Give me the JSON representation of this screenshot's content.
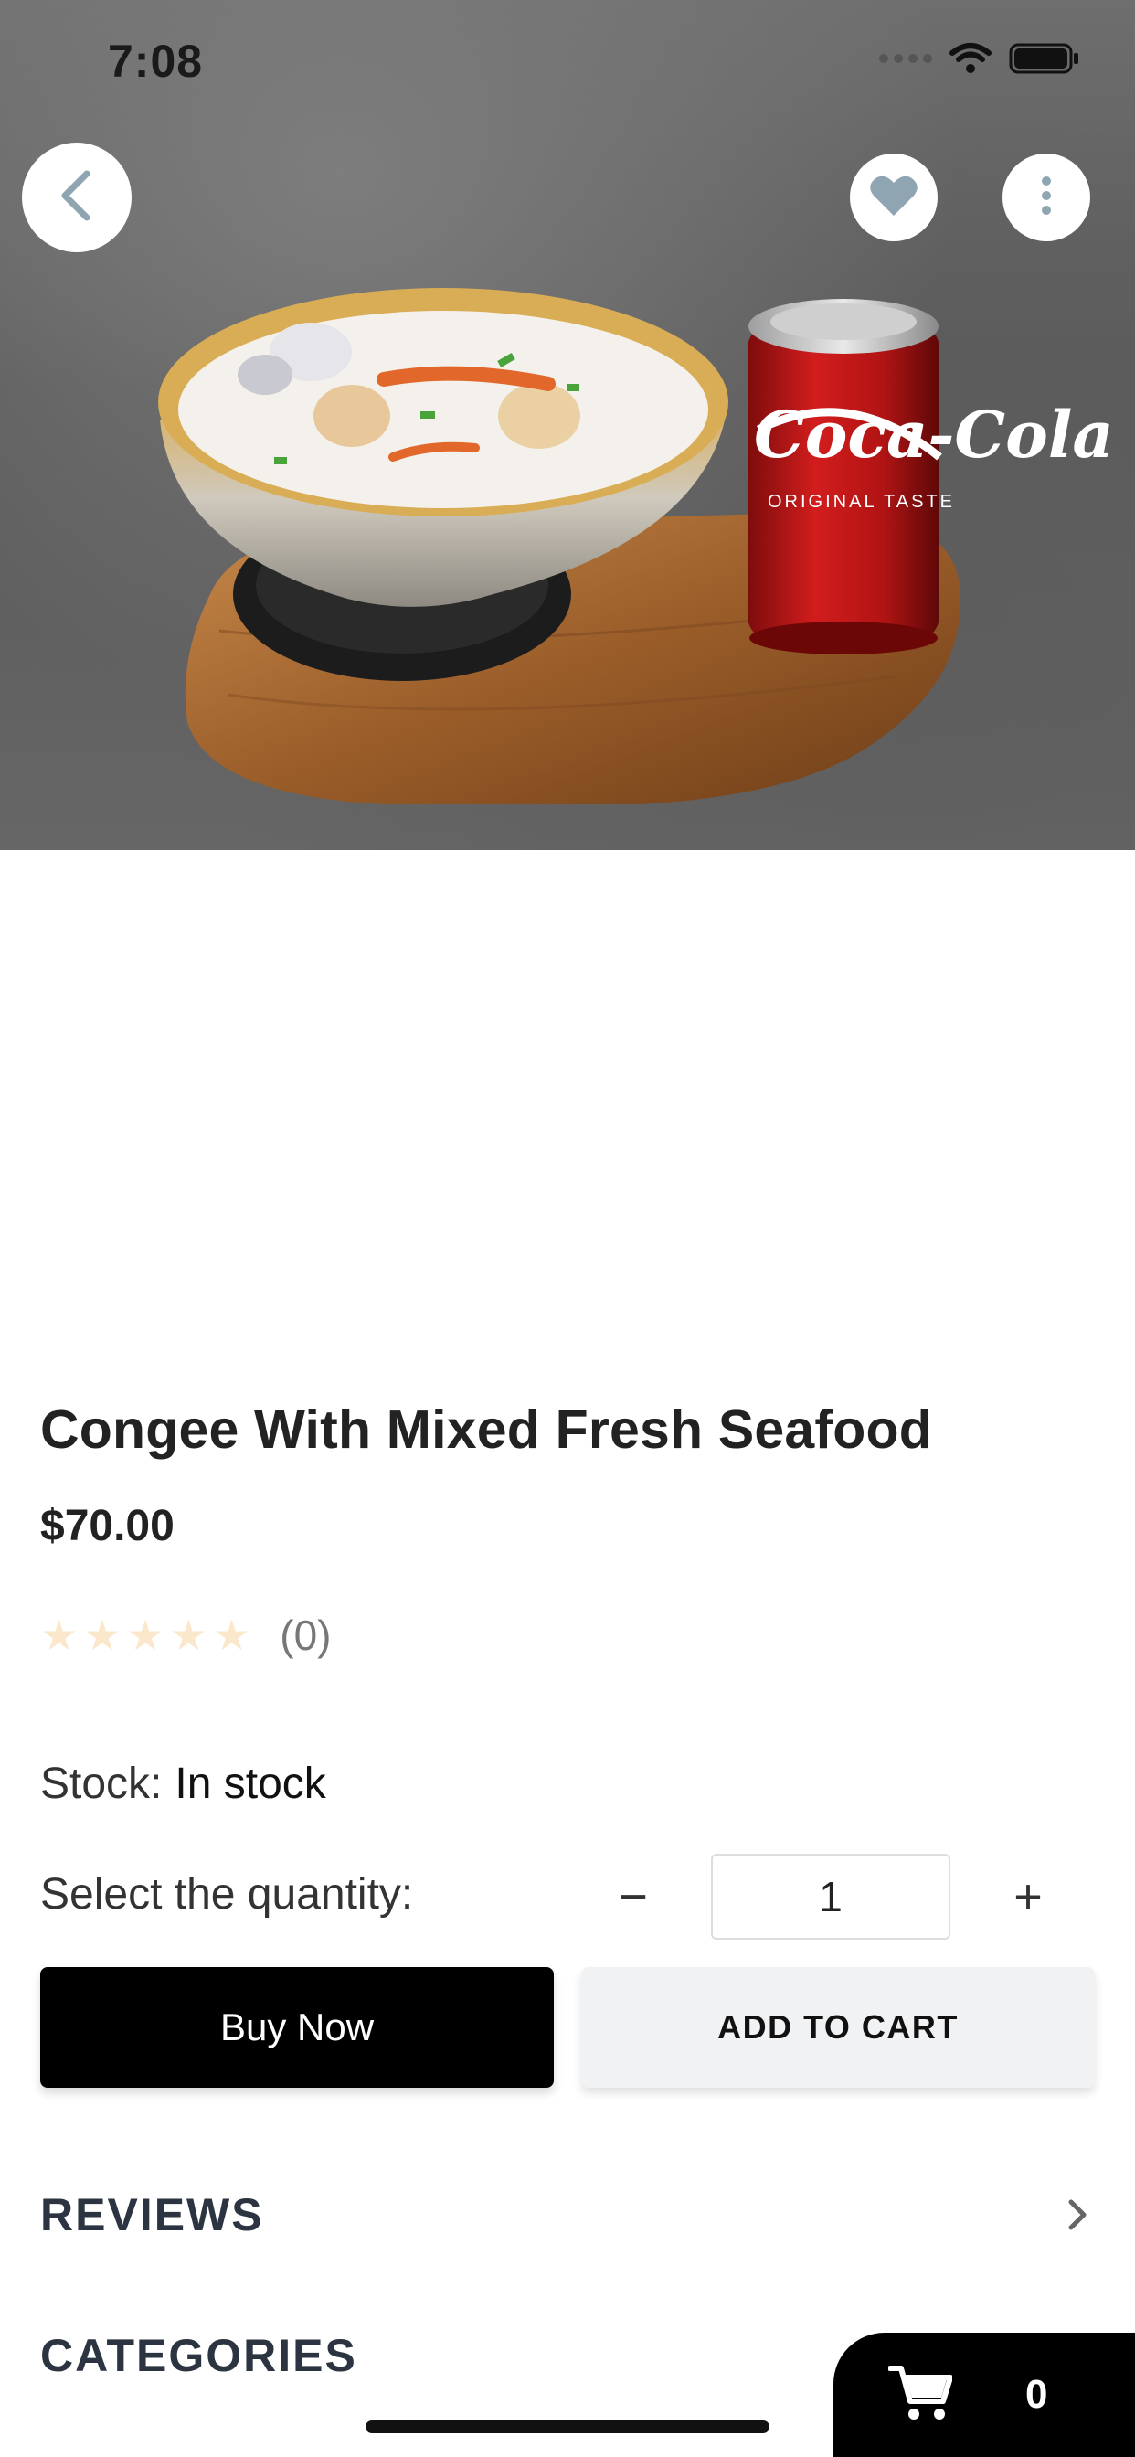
{
  "status_bar": {
    "time": "7:08"
  },
  "product": {
    "title": "Congee With Mixed Fresh Seafood",
    "price": "$70.00",
    "rating_stars": 0,
    "rating_count": "(0)",
    "stock_label": "Stock:",
    "stock_value": "In stock",
    "quantity_label": "Select the quantity:",
    "quantity_value": "1",
    "can_brand_text": "Coca-Cola",
    "can_sub_text": "ORIGINAL TASTE"
  },
  "actions": {
    "buy_now": "Buy Now",
    "add_to_cart": "ADD TO CART",
    "minus": "−",
    "plus": "+"
  },
  "sections": {
    "reviews": "REVIEWS",
    "categories": "CATEGORIES"
  },
  "cart": {
    "count": "0"
  },
  "icons": {
    "back": "chevron-left-icon",
    "favorite": "heart-icon",
    "more": "more-vertical-icon",
    "reviews_arrow": "chevron-right-icon",
    "cart": "cart-icon"
  },
  "colors": {
    "primary_button": "#000000",
    "secondary_button": "#f1f2f4",
    "star_empty": "#fbe7cc",
    "icon_accent": "#8fa6b2"
  }
}
